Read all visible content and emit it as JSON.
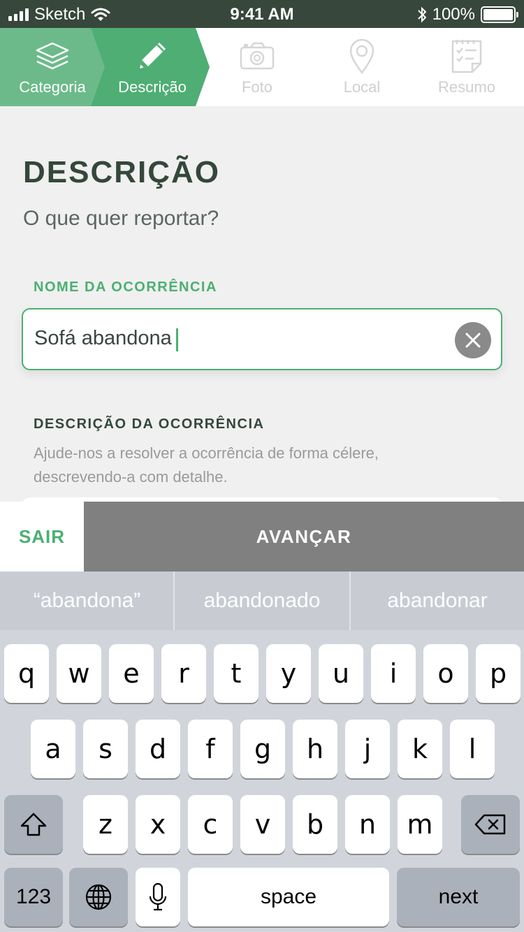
{
  "status_bar": {
    "carrier": "Sketch",
    "time": "9:41 AM",
    "battery": "100%"
  },
  "stepper": {
    "steps": [
      {
        "label": "Categoria",
        "state": "done"
      },
      {
        "label": "Descrição",
        "state": "active"
      },
      {
        "label": "Foto",
        "state": "pending"
      },
      {
        "label": "Local",
        "state": "pending"
      },
      {
        "label": "Resumo",
        "state": "pending"
      }
    ]
  },
  "form": {
    "title": "DESCRIÇÃO",
    "subtitle": "O que quer reportar?",
    "name_label": "NOME DA OCORRÊNCIA",
    "name_value": "Sofá abandona",
    "description_label": "DESCRIÇÃO DA OCORRÊNCIA",
    "description_help": "Ajude-nos a resolver a ocorrência de forma célere, descrevendo-a com detalhe."
  },
  "actions": {
    "exit_label": "SAIR",
    "next_label": "AVANÇAR"
  },
  "keyboard": {
    "suggestions": [
      "“abandona”",
      "abandonado",
      "abandonar"
    ],
    "row1": [
      "q",
      "w",
      "e",
      "r",
      "t",
      "y",
      "u",
      "i",
      "o",
      "p"
    ],
    "row2": [
      "a",
      "s",
      "d",
      "f",
      "g",
      "h",
      "j",
      "k",
      "l"
    ],
    "row3": [
      "z",
      "x",
      "c",
      "v",
      "b",
      "n",
      "m"
    ],
    "numbers_label": "123",
    "space_label": "space",
    "return_label": "next"
  },
  "colors": {
    "accent_green": "#4caf72",
    "status_bar": "#37473b",
    "heading": "#34473b"
  }
}
